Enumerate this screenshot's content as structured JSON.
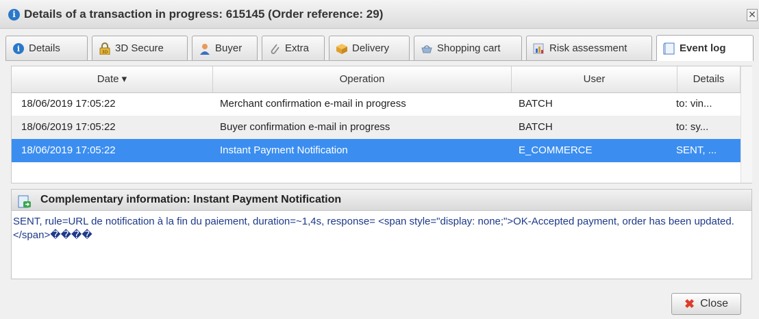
{
  "window": {
    "title": "Details of a transaction in progress: 615145 (Order reference: 29)",
    "close_glyph": "✕"
  },
  "tabs": [
    {
      "label": "Details",
      "icon": "info-icon",
      "active": false
    },
    {
      "label": "3D Secure",
      "icon": "3d-secure-lock-icon",
      "active": false
    },
    {
      "label": "Buyer",
      "icon": "buyer-person-icon",
      "active": false
    },
    {
      "label": "Extra",
      "icon": "paperclip-icon",
      "active": false
    },
    {
      "label": "Delivery",
      "icon": "delivery-box-icon",
      "active": false
    },
    {
      "label": "Shopping cart",
      "icon": "shopping-cart-icon",
      "active": false
    },
    {
      "label": "Risk assessment",
      "icon": "risk-chart-icon",
      "active": false
    },
    {
      "label": "Event log",
      "icon": "event-log-document-icon",
      "active": true
    }
  ],
  "grid": {
    "columns": [
      "Date ▾",
      "Operation",
      "User",
      "Details"
    ],
    "rows": [
      {
        "date": "18/06/2019 17:05:22",
        "operation": "Merchant confirmation e-mail in progress",
        "user": "BATCH",
        "details": "to: vin..."
      },
      {
        "date": "18/06/2019 17:05:22",
        "operation": "Buyer confirmation e-mail in progress",
        "user": "BATCH",
        "details": "to: sy..."
      },
      {
        "date": "18/06/2019 17:05:22",
        "operation": "Instant Payment Notification",
        "user": "E_COMMERCE",
        "details": "SENT, ..."
      }
    ],
    "selected_row": 2
  },
  "complementary": {
    "title": "Complementary information: Instant Payment Notification",
    "text": "SENT, rule=URL de notification à la fin du paiement, duration=~1,4s, response= <span style=\"display: none;\">OK-Accepted payment, order has been updated. </span>����"
  },
  "footer": {
    "close_label": "Close"
  },
  "colors": {
    "selection": "#3b8ef0",
    "info_blue": "#2a78c8",
    "close_red": "#e03b2a"
  }
}
